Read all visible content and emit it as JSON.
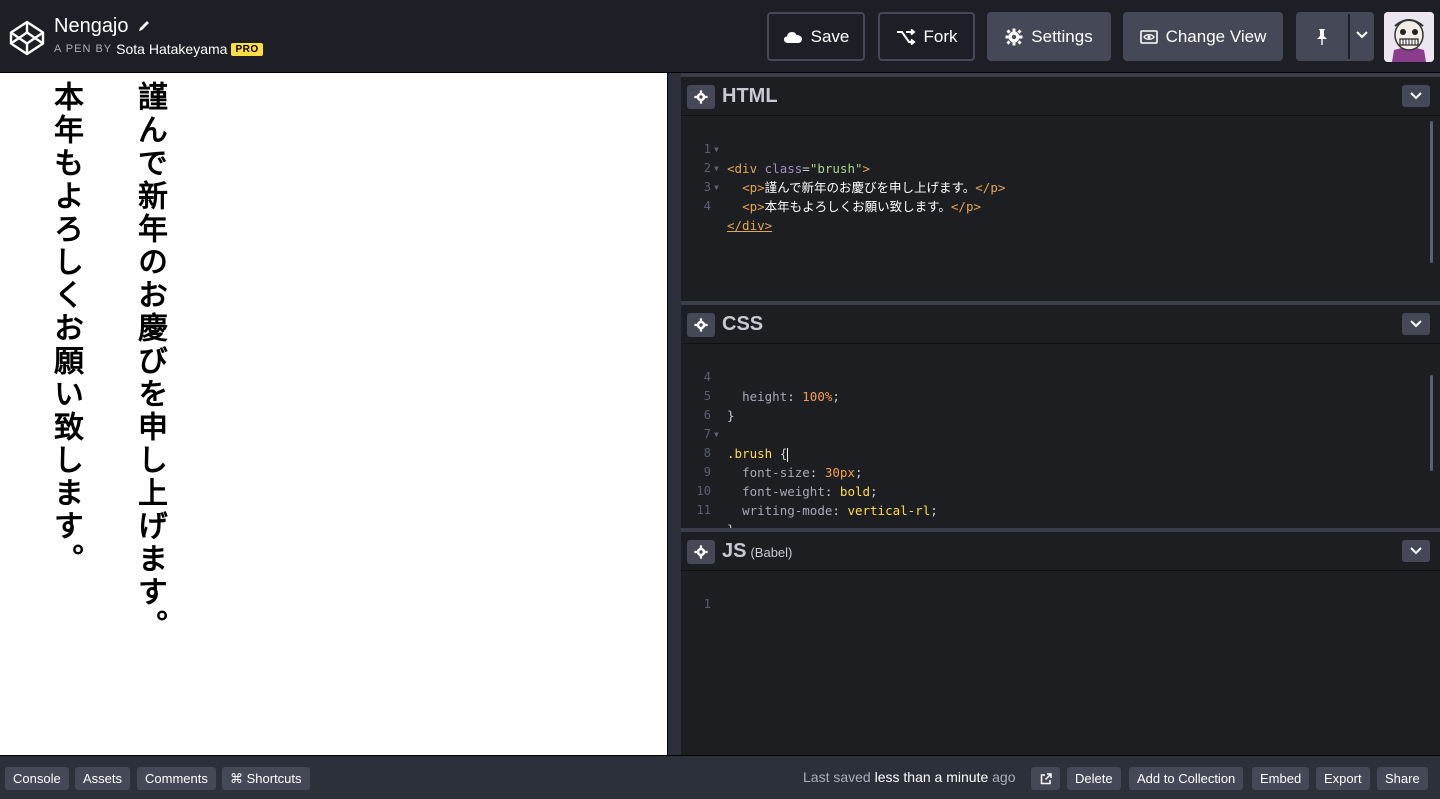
{
  "header": {
    "pen_title": "Nengajo",
    "byline_prefix": "A PEN BY",
    "author": "Sota Hatakeyama",
    "pro_badge": "PRO",
    "buttons": {
      "save": "Save",
      "fork": "Fork",
      "settings": "Settings",
      "change_view": "Change View"
    }
  },
  "preview": {
    "line1": "謹んで新年のお慶びを申し上げます。",
    "line2": "本年もよろしくお願い致します。"
  },
  "editors": {
    "html": {
      "title": "HTML",
      "lines": [
        {
          "num": "1"
        },
        {
          "num": "2"
        },
        {
          "num": "3"
        },
        {
          "num": "4"
        }
      ],
      "code": {
        "l1_open": "<div",
        "l1_attr": "class",
        "l1_eq": "=",
        "l1_str": "\"brush\"",
        "l1_close": ">",
        "l2_open": "<p>",
        "l2_text": "謹んで新年のお慶びを申し上げます。",
        "l2_close": "</p>",
        "l3_open": "<p>",
        "l3_text": "本年もよろしくお願い致します。",
        "l3_close": "</p>",
        "l4": "</div>"
      }
    },
    "css": {
      "title": "CSS",
      "lines": [
        {
          "num": "4"
        },
        {
          "num": "5"
        },
        {
          "num": "6"
        },
        {
          "num": "7"
        },
        {
          "num": "8"
        },
        {
          "num": "9"
        },
        {
          "num": "10"
        },
        {
          "num": "11"
        }
      ],
      "code": {
        "l4_prop": "height",
        "l4_val": "100%",
        "l5": "}",
        "l7_sel": ".brush",
        "l7_brace": "{",
        "l8_prop": "font-size",
        "l8_val": "30px",
        "l9_prop": "font-weight",
        "l9_val": "bold",
        "l10_prop": "writing-mode",
        "l10_val": "vertical-rl",
        "l11": "}"
      }
    },
    "js": {
      "title": "JS",
      "subtitle": "(Babel)",
      "lines": [
        {
          "num": "1"
        }
      ]
    }
  },
  "footer": {
    "console": "Console",
    "assets": "Assets",
    "comments": "Comments",
    "shortcuts": "⌘ Shortcuts",
    "saved_prefix": "Last saved",
    "saved_time": "less than a minute",
    "saved_suffix": "ago",
    "delete": "Delete",
    "add_to_collection": "Add to Collection",
    "embed": "Embed",
    "export": "Export",
    "share": "Share"
  },
  "icons": {
    "logo": "codepen-logo-icon",
    "pencil": "pencil-icon",
    "save": "cloud-icon",
    "fork": "fork-icon",
    "settings": "gear-icon",
    "change_view": "view-icon",
    "pin": "pin-icon",
    "open_external": "external-link-icon"
  },
  "colors": {
    "background": "#1e1f26",
    "editor_bg": "#1d1e22",
    "button_bg": "#444857",
    "pro_badge": "#ffdd40"
  }
}
